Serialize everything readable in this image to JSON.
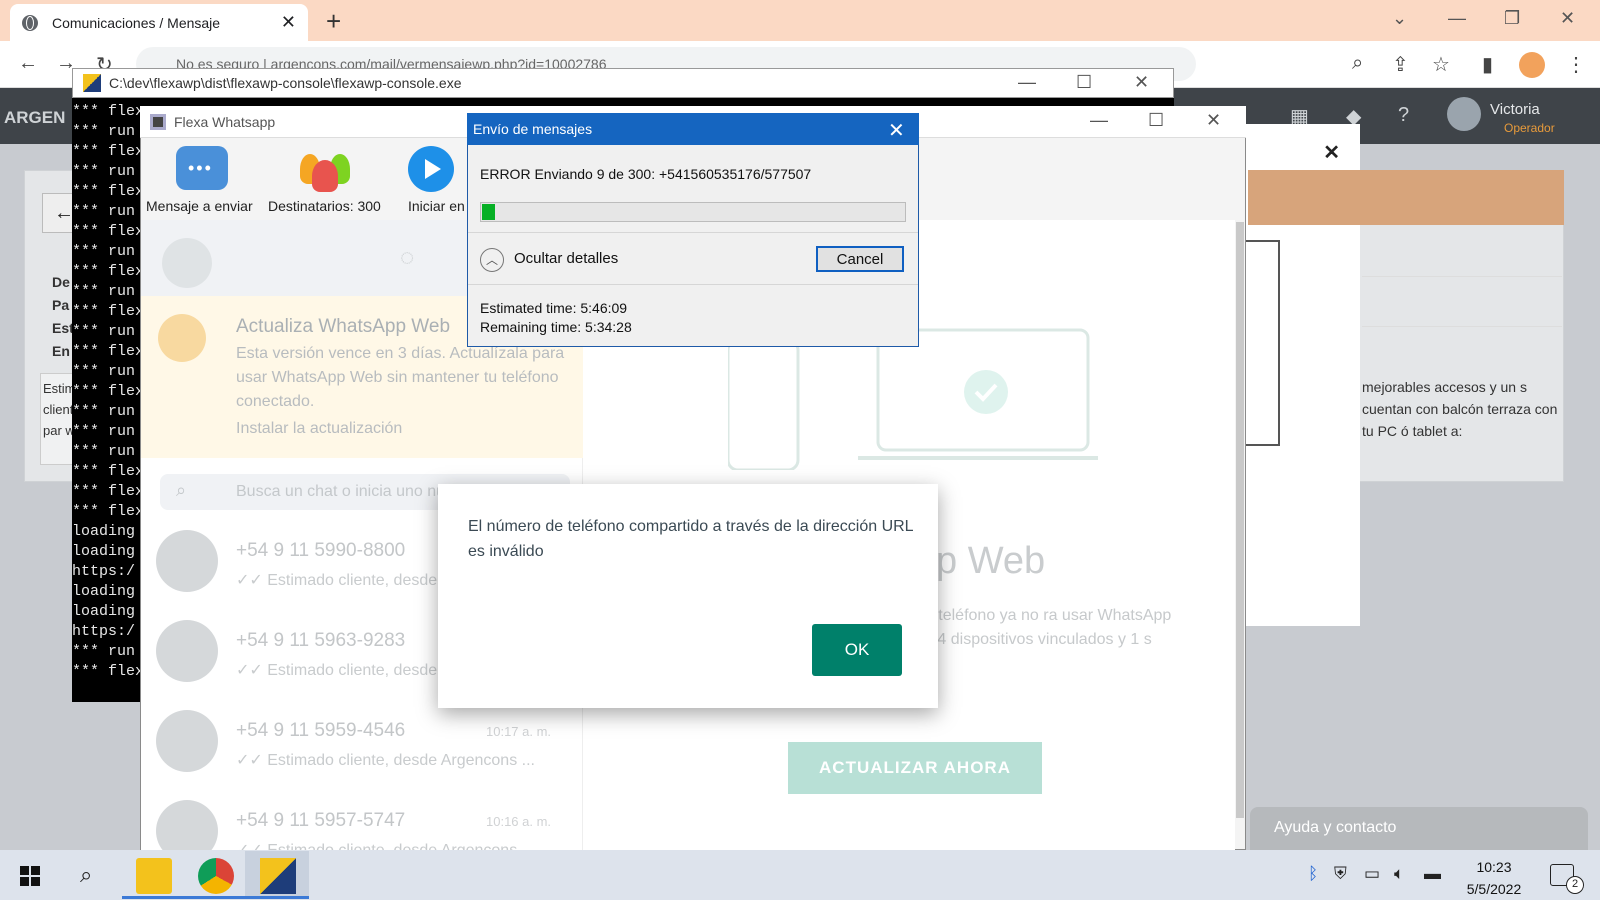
{
  "browser": {
    "tab_title": "Comunicaciones / Mensaje",
    "address_bar": "No es seguro | argencons.com/mail/vermensajewp.php?id=10002786"
  },
  "web": {
    "logo": "ARGEN",
    "user_name": "Victoria",
    "user_role": "Operador",
    "labels": [
      "De",
      "Pa",
      "Est",
      "En"
    ],
    "body_snippet": "Estimado cliente, pulm y par www.",
    "right_text": "mejorables accesos y un s cuentan con balcón terraza con tu PC ó tablet a:",
    "help_label": "Ayuda y contacto"
  },
  "console": {
    "path": "C:\\dev\\flexawp\\dist\\flexawp-console\\flexawp-console.exe",
    "lines": [
      "*** flex",
      "*** run",
      "*** flex",
      "*** run",
      "*** flex",
      "*** run",
      "*** flex",
      "*** run",
      "*** flex",
      "*** run",
      "*** flex",
      "*** run",
      "*** flex",
      "*** run",
      "*** flex",
      "*** run",
      "*** run",
      "*** run",
      "*** flex",
      "*** flex",
      "*** flex",
      "loading",
      "loading",
      "https:/",
      "loading",
      "loading",
      "https:/",
      "*** run",
      "*** flex"
    ]
  },
  "flexa": {
    "title": "Flexa Whatsapp",
    "toolbar": {
      "message_label": "Mensaje a enviar",
      "recipients_label": "Destinatarios: 300",
      "start_label": "Iniciar en"
    }
  },
  "whatsapp": {
    "notice_title": "Actualiza WhatsApp Web",
    "notice_body": "Esta versión vence en 3 días. Actualízala para usar WhatsApp Web sin mantener tu teléfono conectado.",
    "notice_link": "Instalar la actualización",
    "search_placeholder": "Busca un chat o inicia uno nuevo",
    "chats": [
      {
        "name": "+54 9 11 5990-8800",
        "msg": "✓✓ Estimado cliente, desde",
        "time": ""
      },
      {
        "name": "+54 9 11 5963-9283",
        "msg": "✓✓ Estimado cliente, desde",
        "time": ""
      },
      {
        "name": "+54 9 11 5959-4546",
        "msg": "✓✓ Estimado cliente, desde Argencons ...",
        "time": "10:17 a. m."
      },
      {
        "name": "+54 9 11 5957-5747",
        "msg": "✓✓ Estimado cliente, desde Argencons ...",
        "time": "10:16 a. m."
      }
    ],
    "right_title": "tsApp Web",
    "right_text": "ctualización, tu teléfono ya no ra usar WhatsApp Business en ta 4 dispositivos vinculados y 1 s información",
    "update_button": "ACTUALIZAR AHORA"
  },
  "progress_dialog": {
    "title": "Envío de mensajes",
    "message": "ERROR Enviando 9 de 300: +541560535176/577507",
    "progress": 0.03,
    "toggle_label": "Ocultar detalles",
    "cancel_label": "Cancel",
    "estimated": "Estimated time: 5:46:09",
    "remaining": "Remaining time: 5:34:28"
  },
  "alert": {
    "message": "El número de teléfono compartido a través de la dirección URL es inválido",
    "ok_label": "OK"
  },
  "taskbar": {
    "time": "10:23",
    "date": "5/5/2022",
    "notification_count": "2"
  },
  "colors": {
    "progress_green": "#06b025",
    "dialog_blue": "#1565c0",
    "whatsapp_green": "#00806a"
  }
}
